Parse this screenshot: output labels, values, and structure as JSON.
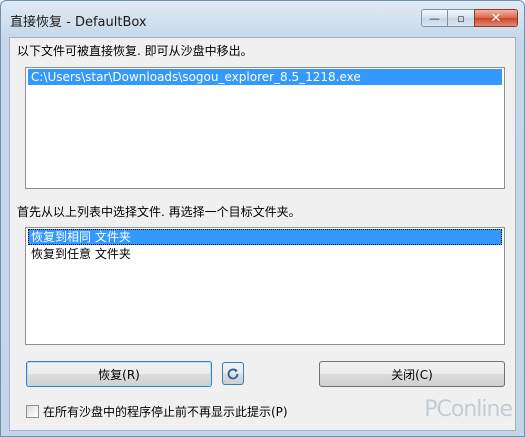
{
  "window": {
    "title": "直接恢复 - DefaultBox",
    "minimize_glyph": "—",
    "maximize_glyph": "▫",
    "close_glyph": "✕"
  },
  "files_section": {
    "label": "以下文件可被直接恢复. 即可从沙盘中移出。",
    "items": [
      {
        "text": "C:\\Users\\star\\Downloads\\sogou_explorer_8.5_1218.exe",
        "selected": true
      }
    ]
  },
  "target_section": {
    "label": "首先从以上列表中选择文件. 再选择一个目标文件夹。",
    "items": [
      {
        "text": "恢复到相同 文件夹",
        "selected": true
      },
      {
        "text": "恢复到任意 文件夹",
        "selected": false
      }
    ]
  },
  "buttons": {
    "restore_label": "恢复(R)",
    "refresh_icon": "refresh-icon",
    "close_label": "关闭(C)"
  },
  "checkbox": {
    "label": "在所有沙盘中的程序停止前不再显示此提示(P)",
    "checked": false
  },
  "watermark": {
    "text": "PConline"
  }
}
